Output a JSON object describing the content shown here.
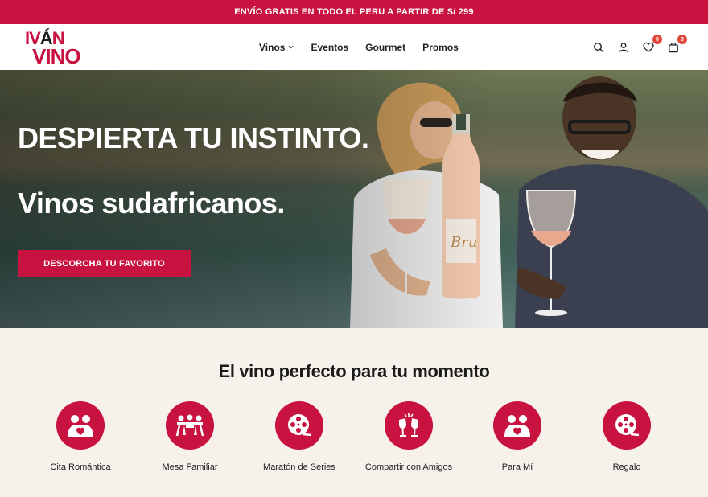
{
  "announcement": "ENVÍO GRATIS EN TODO EL PERU A PARTIR DE S/ 299",
  "logo": {
    "line1_a": "IV",
    "line1_accent": "Á",
    "line1_b": "N",
    "line2": "VINO"
  },
  "nav": {
    "items": [
      "Vinos",
      "Eventos",
      "Gourmet",
      "Promos"
    ]
  },
  "header_icons": {
    "search": "search-icon",
    "account": "user-icon",
    "wishlist": "heart-icon",
    "wishlist_count": "0",
    "cart": "cart-icon",
    "cart_count": "0"
  },
  "hero": {
    "headline": "DESPIERTA TU INSTINTO.",
    "subheadline": "Vinos sudafricanos.",
    "cta": "DESCORCHA TU FAVORITO"
  },
  "moments": {
    "title": "El vino perfecto para tu momento",
    "items": [
      {
        "label": "Cita Romántica",
        "icon": "couple-heart-icon"
      },
      {
        "label": "Mesa Familiar",
        "icon": "family-table-icon"
      },
      {
        "label": "Maratón de Series",
        "icon": "film-reel-icon"
      },
      {
        "label": "Compartir con Amigos",
        "icon": "toast-glasses-icon"
      },
      {
        "label": "Para Mí",
        "icon": "couple-heart-icon"
      },
      {
        "label": "Regalo",
        "icon": "film-reel-icon"
      }
    ]
  },
  "colors": {
    "brand": "#c8123f",
    "background": "#f7f1ec",
    "badge": "#e0473b"
  }
}
